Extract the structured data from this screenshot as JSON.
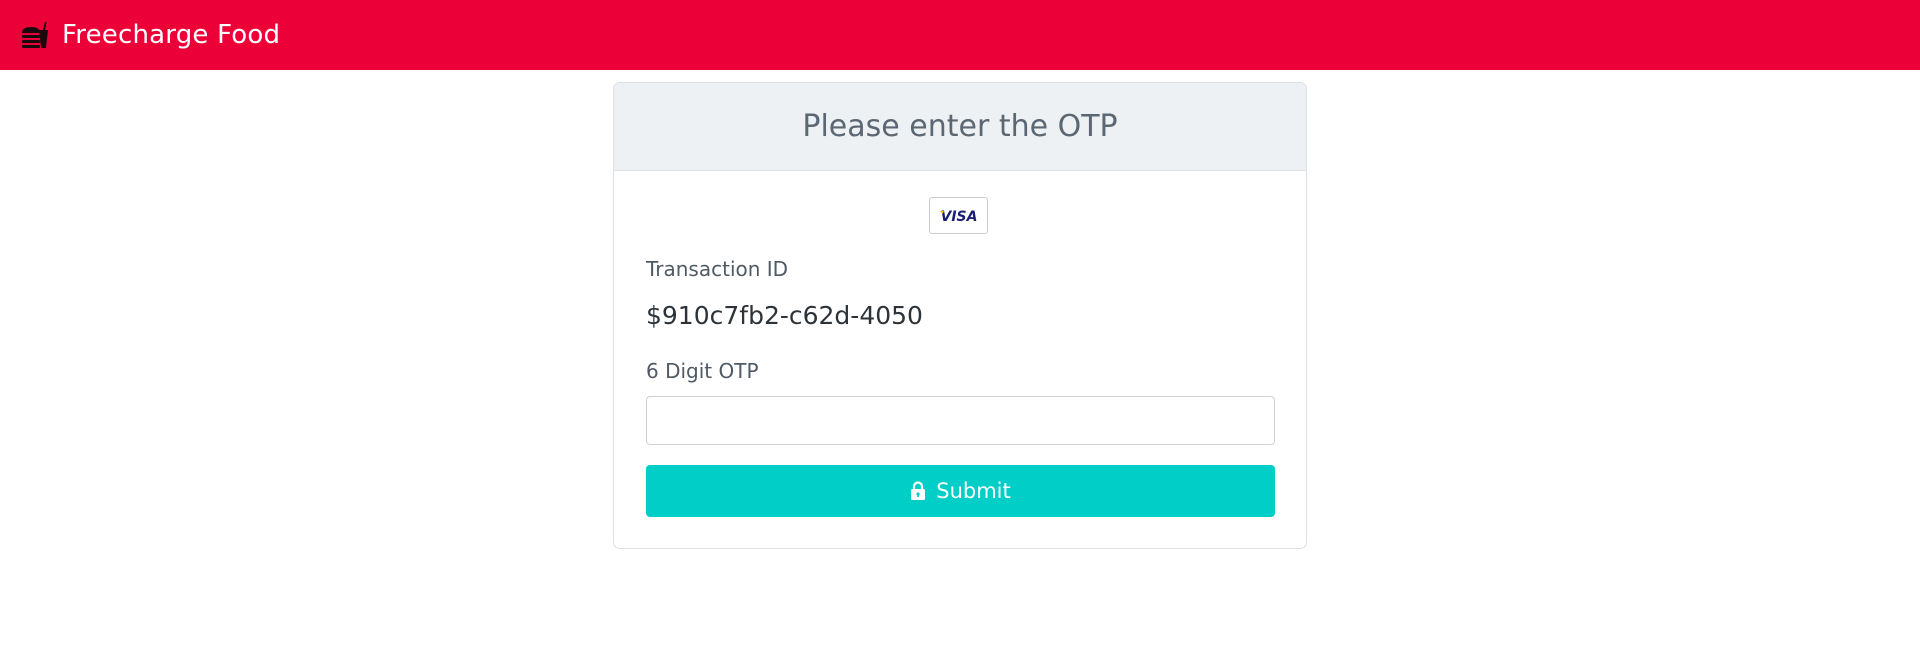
{
  "navbar": {
    "brand_icon": "food-burger-drink-icon",
    "brand_title": "Freecharge Food",
    "color": "#ec0038"
  },
  "card": {
    "title": "Please enter the OTP",
    "card_brand_logo": {
      "icon": "visa-logo",
      "text": "VISA"
    },
    "transaction_label": "Transaction ID",
    "transaction_id": "$910c7fb2-c62d-4050",
    "otp_label": "6 Digit OTP",
    "otp_value": "",
    "submit_label": "Submit",
    "submit_icon": "lock-icon",
    "accent_color": "#00cec7"
  }
}
